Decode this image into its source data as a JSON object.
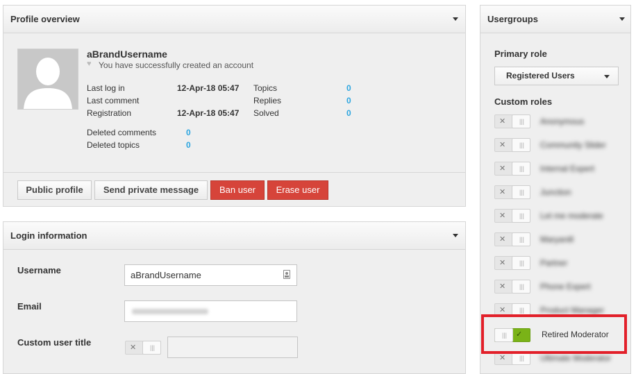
{
  "profile": {
    "title": "Profile overview",
    "username": "aBrandUsername",
    "status_message": "You have successfully created an account",
    "stats": {
      "last_login_label": "Last log in",
      "last_login_value": "12-Apr-18 05:47",
      "last_comment_label": "Last comment",
      "last_comment_value": "",
      "registration_label": "Registration",
      "registration_value": "12-Apr-18 05:47",
      "topics_label": "Topics",
      "topics_value": "0",
      "replies_label": "Replies",
      "replies_value": "0",
      "solved_label": "Solved",
      "solved_value": "0",
      "deleted_comments_label": "Deleted comments",
      "deleted_comments_value": "0",
      "deleted_topics_label": "Deleted topics",
      "deleted_topics_value": "0"
    },
    "buttons": {
      "public_profile": "Public profile",
      "send_message": "Send private message",
      "ban_user": "Ban user",
      "erase_user": "Erase user"
    }
  },
  "login": {
    "title": "Login information",
    "username_label": "Username",
    "username_value": "aBrandUsername",
    "email_label": "Email",
    "email_value": "",
    "custom_title_label": "Custom user title",
    "custom_title_value": "",
    "custom_title_enabled": false
  },
  "usergroups": {
    "title": "Usergroups",
    "primary_role_label": "Primary role",
    "primary_role_value": "Registered Users",
    "custom_roles_label": "Custom roles",
    "retired_moderator_label": "Retired Moderator",
    "retired_moderator_enabled": true,
    "blurred_role_count": 9
  },
  "colors": {
    "accent_blue": "#2ea6e0",
    "danger_red": "#d6443a",
    "toggle_on_green": "#7ab317",
    "highlight_red": "#e2202a"
  }
}
